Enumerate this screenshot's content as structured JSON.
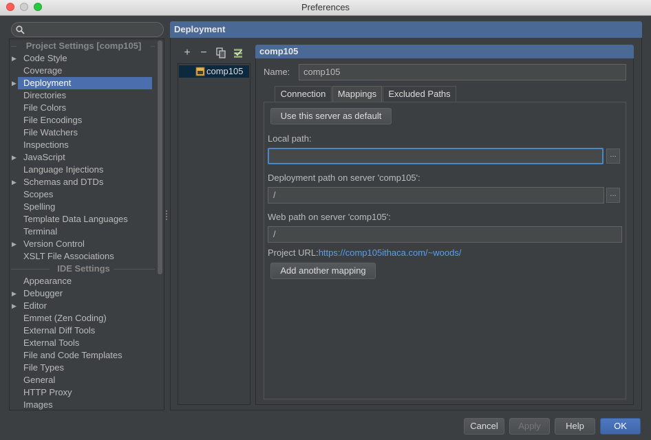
{
  "window": {
    "title": "Preferences"
  },
  "search": {
    "placeholder": ""
  },
  "tree": {
    "project_header": "Project Settings [comp105]",
    "project_items": [
      {
        "label": "Code Style",
        "expandable": true
      },
      {
        "label": "Coverage",
        "expandable": false
      },
      {
        "label": "Deployment",
        "expandable": true,
        "selected": true
      },
      {
        "label": "Directories",
        "expandable": false
      },
      {
        "label": "File Colors",
        "expandable": false
      },
      {
        "label": "File Encodings",
        "expandable": false
      },
      {
        "label": "File Watchers",
        "expandable": false
      },
      {
        "label": "Inspections",
        "expandable": false
      },
      {
        "label": "JavaScript",
        "expandable": true
      },
      {
        "label": "Language Injections",
        "expandable": false
      },
      {
        "label": "Schemas and DTDs",
        "expandable": true
      },
      {
        "label": "Scopes",
        "expandable": false
      },
      {
        "label": "Spelling",
        "expandable": false
      },
      {
        "label": "Template Data Languages",
        "expandable": false
      },
      {
        "label": "Terminal",
        "expandable": false
      },
      {
        "label": "Version Control",
        "expandable": true
      },
      {
        "label": "XSLT File Associations",
        "expandable": false
      }
    ],
    "ide_header": "IDE Settings",
    "ide_items": [
      {
        "label": "Appearance",
        "expandable": false
      },
      {
        "label": "Debugger",
        "expandable": true
      },
      {
        "label": "Editor",
        "expandable": true
      },
      {
        "label": "Emmet (Zen Coding)",
        "expandable": false
      },
      {
        "label": "External Diff Tools",
        "expandable": false
      },
      {
        "label": "External Tools",
        "expandable": false
      },
      {
        "label": "File and Code Templates",
        "expandable": false
      },
      {
        "label": "File Types",
        "expandable": false
      },
      {
        "label": "General",
        "expandable": false
      },
      {
        "label": "HTTP Proxy",
        "expandable": false
      },
      {
        "label": "Images",
        "expandable": false
      }
    ]
  },
  "deployment": {
    "header": "Deployment",
    "toolbar": {
      "add": "+",
      "remove": "−"
    },
    "servers": [
      {
        "label": "comp105"
      }
    ],
    "detail": {
      "header": "comp105",
      "name_label": "Name:",
      "name_value": "comp105",
      "tabs": [
        {
          "label": "Connection",
          "active": false
        },
        {
          "label": "Mappings",
          "active": true
        },
        {
          "label": "Excluded Paths",
          "active": false
        }
      ],
      "mappings": {
        "default_button": "Use this server as default",
        "local_path_label": "Local path:",
        "local_path_value": "",
        "deploy_path_label": "Deployment path on server 'comp105':",
        "deploy_path_value": "/",
        "web_path_label": "Web path on server 'comp105':",
        "web_path_value": "/",
        "project_url_label": "Project URL:",
        "project_url_value": "https://comp105ithaca.com/~woods/",
        "add_mapping_button": "Add another mapping",
        "browse": "..."
      }
    }
  },
  "footer": {
    "cancel": "Cancel",
    "apply": "Apply",
    "help": "Help",
    "ok": "OK"
  },
  "colors": {
    "accent": "#4b6eaf",
    "link": "#589df6",
    "background": "#3c3f41"
  }
}
